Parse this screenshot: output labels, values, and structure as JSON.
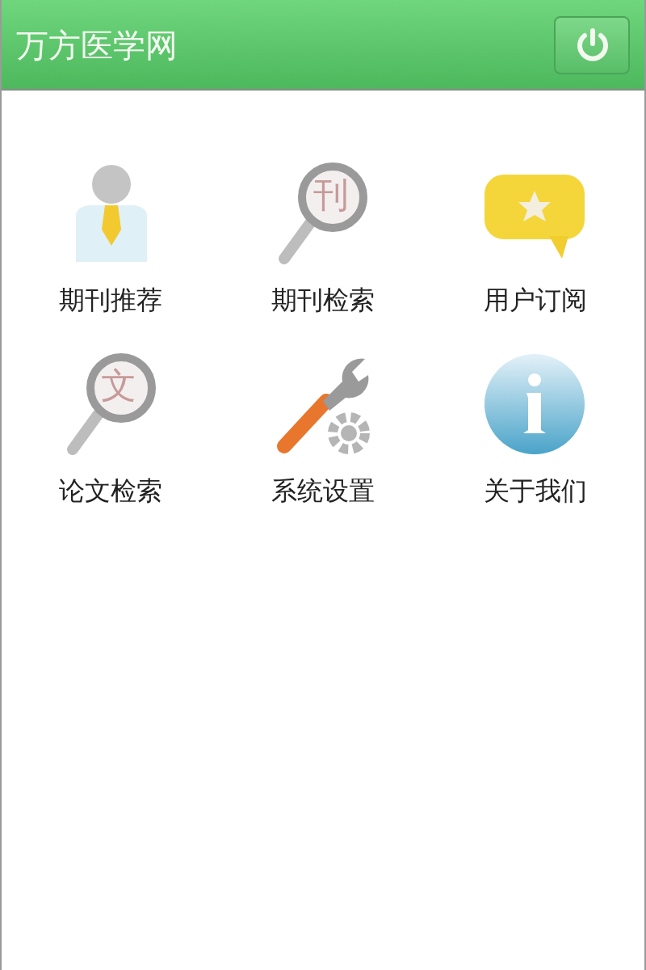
{
  "header": {
    "title": "万方医学网"
  },
  "menu": [
    {
      "label": "期刊推荐",
      "kind": "person"
    },
    {
      "label": "期刊检索",
      "kind": "magnifier",
      "glyph": "刊"
    },
    {
      "label": "用户订阅",
      "kind": "chat"
    },
    {
      "label": "论文检索",
      "kind": "magnifier",
      "glyph": "文"
    },
    {
      "label": "系统设置",
      "kind": "tools"
    },
    {
      "label": "关于我们",
      "kind": "info"
    }
  ]
}
